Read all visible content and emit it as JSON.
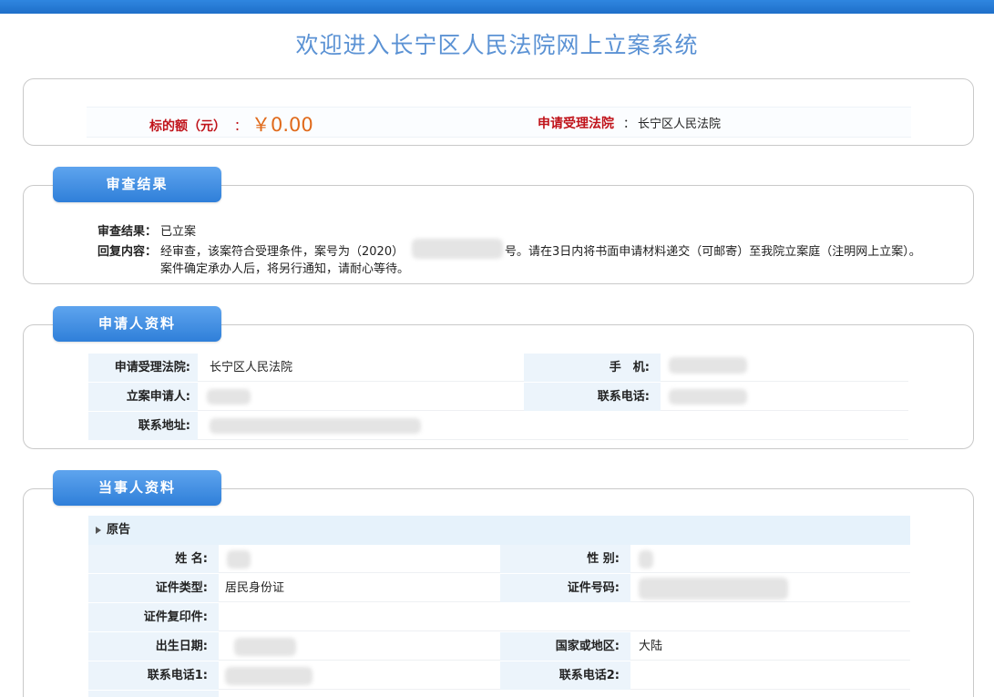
{
  "page_title": "欢迎进入长宁区人民法院网上立案系统",
  "summary": {
    "amount_label": "标的额（元）",
    "amount_colon": "：",
    "amount_value": "￥0.00",
    "court_label": "申请受理法院",
    "court_colon": "：",
    "court_value": "长宁区人民法院"
  },
  "review": {
    "tab": "审查结果",
    "result_label": "审查结果：",
    "result_value": "已立案",
    "reply_label": "回复内容：",
    "reply_line1_a": "经审查，该案符合受理条件，案号为（2020）",
    "reply_line1_b": "号。请在3日内将书面申请材料递交（可邮寄）至我院立案庭（注明网上立案）。",
    "reply_line2": "案件确定承办人后，将另行通知，请耐心等待。"
  },
  "applicant": {
    "tab": "申请人资料",
    "court_label": "申请受理法院:",
    "court_value": "长宁区人民法院",
    "mobile_label": "手　机:",
    "filer_label": "立案申请人:",
    "phone_label": "联系电话:",
    "address_label": "联系地址:"
  },
  "party": {
    "tab": "当事人资料",
    "section": "原告",
    "name_label": "姓 名:",
    "gender_label": "性 别:",
    "id_type_label": "证件类型:",
    "id_type_value": "居民身份证",
    "id_no_label": "证件号码:",
    "id_copy_label": "证件复印件:",
    "birth_label": "出生日期:",
    "region_label": "国家或地区:",
    "region_value": "大陆",
    "phone1_label": "联系电话1:",
    "phone2_label": "联系电话2:"
  },
  "colors": {
    "header_bar": "#1e6fc9",
    "title_text": "#5b92d4",
    "tab_blue": "#2f7fd9",
    "label_red": "#c0131a",
    "amount_orange": "#e06a1b",
    "label_bg": "#ecf4fb"
  }
}
